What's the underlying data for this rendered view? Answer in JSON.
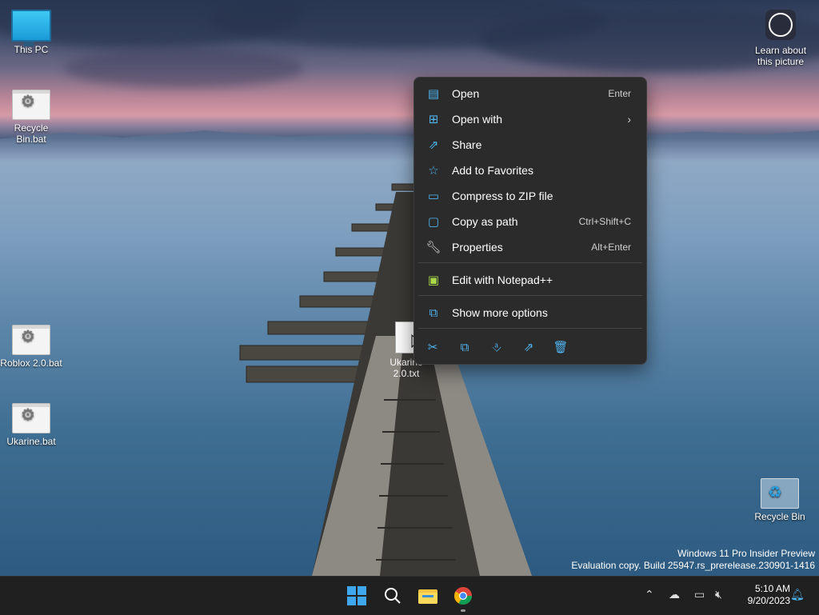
{
  "desktop": {
    "icons": [
      {
        "label": "This PC",
        "icon": "monitor-icon"
      },
      {
        "label": "Recycle Bin.bat",
        "icon": "batch-file-icon"
      },
      {
        "label": "Roblox 2.0.bat",
        "icon": "batch-file-icon"
      },
      {
        "label": "Ukarine.bat",
        "icon": "batch-file-icon"
      },
      {
        "label": "Recycle Bin",
        "icon": "recycle-bin-icon"
      }
    ],
    "learn_label": "Learn about this picture",
    "selected_file": "Ukarine 2.0.txt",
    "watermark_line1": "Windows 11 Pro Insider Preview",
    "watermark_line2": "Evaluation copy. Build 25947.rs_prerelease.230901-1416"
  },
  "context_menu": {
    "items": [
      {
        "label": "Open",
        "shortcut": "Enter",
        "icon": "notepad-icon"
      },
      {
        "label": "Open with",
        "shortcut": "",
        "icon": "open-with-icon",
        "submenu": true
      },
      {
        "label": "Share",
        "shortcut": "",
        "icon": "share-icon"
      },
      {
        "label": "Add to Favorites",
        "shortcut": "",
        "icon": "star-icon"
      },
      {
        "label": "Compress to ZIP file",
        "shortcut": "",
        "icon": "zip-folder-icon"
      },
      {
        "label": "Copy as path",
        "shortcut": "Ctrl+Shift+C",
        "icon": "copy-path-icon"
      },
      {
        "label": "Properties",
        "shortcut": "Alt+Enter",
        "icon": "wrench-icon"
      },
      {
        "label": "Edit with Notepad++",
        "shortcut": "",
        "icon": "notepadpp-icon"
      },
      {
        "label": "Show more options",
        "shortcut": "",
        "icon": "more-options-icon"
      }
    ],
    "toolbar": [
      "cut-icon",
      "copy-icon",
      "rename-icon",
      "share-icon",
      "delete-icon"
    ]
  },
  "taskbar": {
    "apps": [
      "start-icon",
      "search-icon",
      "file-explorer-icon",
      "chrome-icon"
    ],
    "time": "5:10 AM",
    "date": "9/20/2023"
  },
  "colors": {
    "accent": "#4fb5f0",
    "menu_bg": "#2b2b2b",
    "taskbar_bg": "#202020"
  }
}
